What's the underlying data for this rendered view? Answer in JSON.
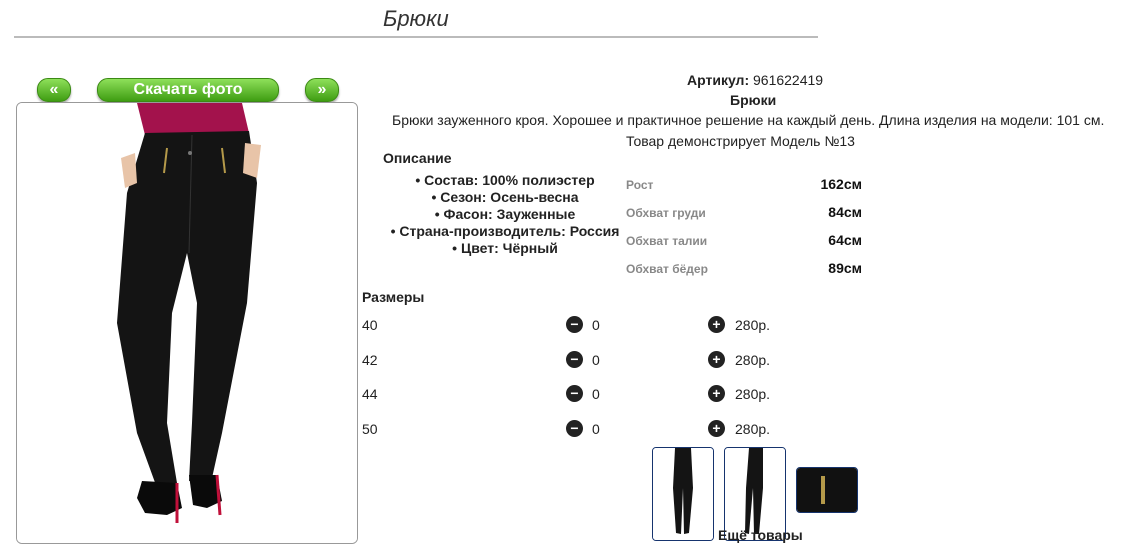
{
  "page": {
    "title": "Брюки"
  },
  "gallery": {
    "prev_label": "«",
    "next_label": "»",
    "download_label": "Скачать фото"
  },
  "product": {
    "article_label": "Артикул:",
    "article_value": "961622419",
    "name": "Брюки",
    "description": "Брюки зауженного кроя. Хорошее и практичное решение на каждый день. Длина изделия на модели: 101 см.",
    "model_line": "Товар демонстрирует Модель №13",
    "desc_heading": "Описание",
    "features": [
      "Состав: 100% полиэстер",
      "Сезон: Осень-весна",
      "Фасон: Зауженные",
      "Страна-производитель: Россия",
      "Цвет: Чёрный"
    ]
  },
  "model_measures": [
    {
      "label": "Рост",
      "value": "162см"
    },
    {
      "label": "Обхват груди",
      "value": "84см"
    },
    {
      "label": "Обхват талии",
      "value": "64см"
    },
    {
      "label": "Обхват бёдер",
      "value": "89см"
    }
  ],
  "sizes": {
    "heading": "Размеры",
    "rows": [
      {
        "size": "40",
        "qty": "0",
        "price": "280р."
      },
      {
        "size": "42",
        "qty": "0",
        "price": "280р."
      },
      {
        "size": "44",
        "qty": "0",
        "price": "280р."
      },
      {
        "size": "50",
        "qty": "0",
        "price": "280р."
      }
    ]
  },
  "more_goods_label": "Ещё товары"
}
